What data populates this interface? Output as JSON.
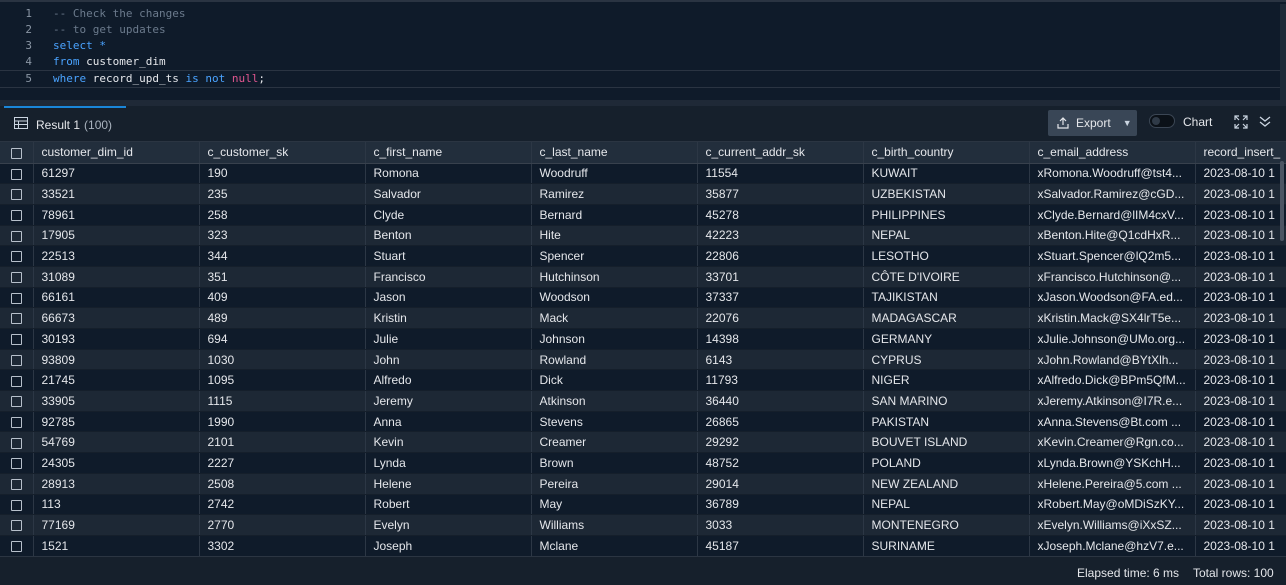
{
  "editor": {
    "lines": [
      {
        "num": "1",
        "parts": [
          {
            "t": "-- Check the changes",
            "c": "c-comment"
          }
        ]
      },
      {
        "num": "2",
        "parts": [
          {
            "t": "-- to get updates",
            "c": "c-comment"
          }
        ]
      },
      {
        "num": "3",
        "parts": [
          {
            "t": "select *",
            "c": "c-kw"
          }
        ]
      },
      {
        "num": "4",
        "parts": [
          {
            "t": "from ",
            "c": "c-kw"
          },
          {
            "t": "customer_dim",
            "c": "c-text"
          }
        ]
      },
      {
        "num": "5",
        "parts": [
          {
            "t": "where ",
            "c": "c-kw"
          },
          {
            "t": "record_upd_ts ",
            "c": "c-text"
          },
          {
            "t": "is not ",
            "c": "c-kw"
          },
          {
            "t": "null",
            "c": "c-null"
          },
          {
            "t": ";",
            "c": "c-text"
          }
        ]
      }
    ]
  },
  "result_tab": {
    "label": "Result 1",
    "count": "(100)"
  },
  "toolbar": {
    "export_label": "Export",
    "chart_label": "Chart"
  },
  "columns": [
    "customer_dim_id",
    "c_customer_sk",
    "c_first_name",
    "c_last_name",
    "c_current_addr_sk",
    "c_birth_country",
    "c_email_address",
    "record_insert_"
  ],
  "rows": [
    [
      "61297",
      "190",
      "Romona",
      "Woodruff",
      "11554",
      "KUWAIT",
      "xRomona.Woodruff@tst4...",
      "2023-08-10 1"
    ],
    [
      "33521",
      "235",
      "Salvador",
      "Ramirez",
      "35877",
      "UZBEKISTAN",
      "xSalvador.Ramirez@cGD...",
      "2023-08-10 1"
    ],
    [
      "78961",
      "258",
      "Clyde",
      "Bernard",
      "45278",
      "PHILIPPINES",
      "xClyde.Bernard@lIM4cxV...",
      "2023-08-10 1"
    ],
    [
      "17905",
      "323",
      "Benton",
      "Hite",
      "42223",
      "NEPAL",
      "xBenton.Hite@Q1cdHxR...",
      "2023-08-10 1"
    ],
    [
      "22513",
      "344",
      "Stuart",
      "Spencer",
      "22806",
      "LESOTHO",
      "xStuart.Spencer@lQ2m5...",
      "2023-08-10 1"
    ],
    [
      "31089",
      "351",
      "Francisco",
      "Hutchinson",
      "33701",
      "CÔTE D'IVOIRE",
      "xFrancisco.Hutchinson@...",
      "2023-08-10 1"
    ],
    [
      "66161",
      "409",
      "Jason",
      "Woodson",
      "37337",
      "TAJIKISTAN",
      "xJason.Woodson@FA.ed...",
      "2023-08-10 1"
    ],
    [
      "66673",
      "489",
      "Kristin",
      "Mack",
      "22076",
      "MADAGASCAR",
      "xKristin.Mack@SX4lrT5e...",
      "2023-08-10 1"
    ],
    [
      "30193",
      "694",
      "Julie",
      "Johnson",
      "14398",
      "GERMANY",
      "xJulie.Johnson@UMo.org...",
      "2023-08-10 1"
    ],
    [
      "93809",
      "1030",
      "John",
      "Rowland",
      "6143",
      "CYPRUS",
      "xJohn.Rowland@BYtXlh...",
      "2023-08-10 1"
    ],
    [
      "21745",
      "1095",
      "Alfredo",
      "Dick",
      "11793",
      "NIGER",
      "xAlfredo.Dick@BPm5QfM...",
      "2023-08-10 1"
    ],
    [
      "33905",
      "1115",
      "Jeremy",
      "Atkinson",
      "36440",
      "SAN MARINO",
      "xJeremy.Atkinson@I7R.e...",
      "2023-08-10 1"
    ],
    [
      "92785",
      "1990",
      "Anna",
      "Stevens",
      "26865",
      "PAKISTAN",
      "xAnna.Stevens@Bt.com ...",
      "2023-08-10 1"
    ],
    [
      "54769",
      "2101",
      "Kevin",
      "Creamer",
      "29292",
      "BOUVET ISLAND",
      "xKevin.Creamer@Rgn.co...",
      "2023-08-10 1"
    ],
    [
      "24305",
      "2227",
      "Lynda",
      "Brown",
      "48752",
      "POLAND",
      "xLynda.Brown@YSKchH...",
      "2023-08-10 1"
    ],
    [
      "28913",
      "2508",
      "Helene",
      "Pereira",
      "29014",
      "NEW ZEALAND",
      "xHelene.Pereira@5.com ...",
      "2023-08-10 1"
    ],
    [
      "113",
      "2742",
      "Robert",
      "May",
      "36789",
      "NEPAL",
      "xRobert.May@oMDiSzKY...",
      "2023-08-10 1"
    ],
    [
      "77169",
      "2770",
      "Evelyn",
      "Williams",
      "3033",
      "MONTENEGRO",
      "xEvelyn.Williams@iXxSZ...",
      "2023-08-10 1"
    ],
    [
      "1521",
      "3302",
      "Joseph",
      "Mclane",
      "45187",
      "SURINAME",
      "xJoseph.Mclane@hzV7.e...",
      "2023-08-10 1"
    ]
  ],
  "status": {
    "elapsed": "Elapsed time: 6 ms",
    "total_rows": "Total rows: 100"
  }
}
